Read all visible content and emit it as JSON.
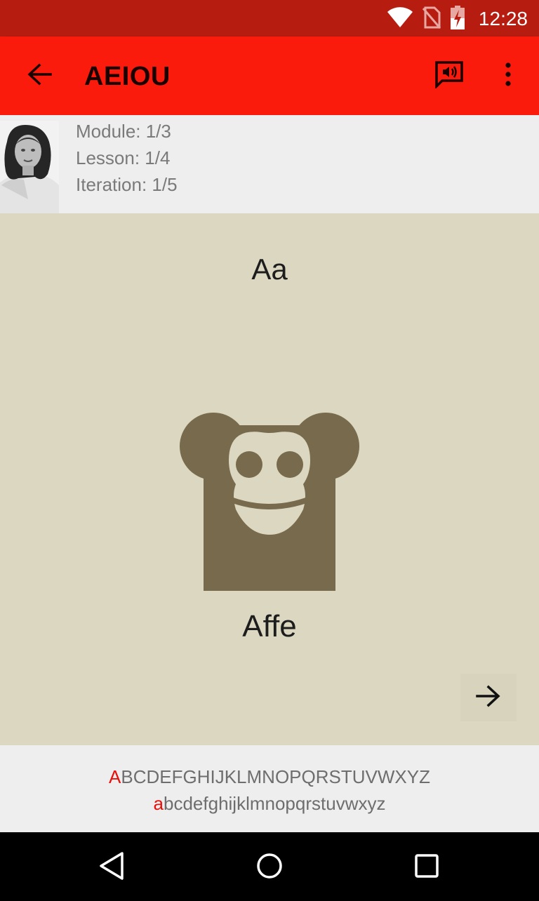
{
  "status_bar": {
    "time": "12:28",
    "icons": [
      "wifi-icon",
      "no-sim-icon",
      "battery-charging-icon"
    ]
  },
  "app_bar": {
    "title": "AEIOU",
    "color": "#fb1b0c",
    "actions": [
      "back-arrow-icon",
      "speak-icon",
      "overflow-menu-icon"
    ]
  },
  "progress": {
    "module": "Module: 1/3",
    "lesson": "Lesson: 1/4",
    "iteration": "Iteration: 1/5"
  },
  "card": {
    "letters": "Aa",
    "image_icon": "monkey-icon",
    "word": "Affe",
    "next_icon": "arrow-right-icon",
    "background": "#dcd7c0"
  },
  "alphabet": {
    "upper_highlight": "A",
    "upper_rest": "BCDEFGHIJKLMNOPQRSTUVWXYZ",
    "lower_highlight": "a",
    "lower_rest": "bcdefghijklmnopqrstuvwxyz",
    "highlight_color": "#e8100a"
  },
  "nav_bar": {
    "buttons": [
      "back-triangle-icon",
      "home-circle-icon",
      "recents-square-icon"
    ]
  }
}
